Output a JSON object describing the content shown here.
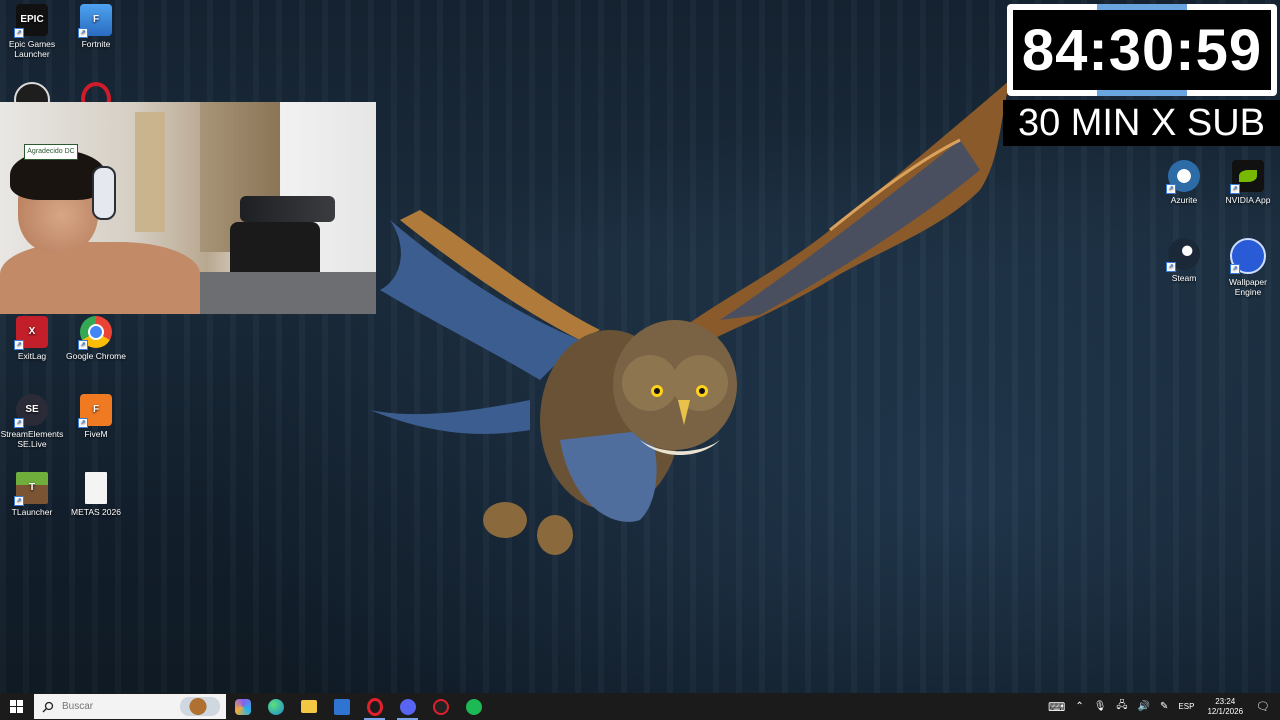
{
  "desktop_icons": [
    {
      "label": "Epic Games Launcher",
      "color": "#111111",
      "glyph": "EPIC"
    },
    {
      "label": "Fortnite",
      "color": "#3a86d9",
      "glyph": "F"
    },
    {
      "label": "ExitLag",
      "color": "#c21f2a",
      "glyph": "X"
    },
    {
      "label": "Google Chrome",
      "color": "#ffffff",
      "glyph": ""
    },
    {
      "label": "StreamElements SE.Live",
      "color": "#2b2b38",
      "glyph": "SE"
    },
    {
      "label": "FiveM",
      "color": "#f07a22",
      "glyph": "F"
    },
    {
      "label": "TLauncher",
      "color": "#5c8e2f",
      "glyph": "T"
    },
    {
      "label": "METAS 2026",
      "color": "#f1f1f1",
      "glyph": ""
    },
    {
      "label": "Azurite",
      "color": "#2e6ca8",
      "glyph": "A"
    },
    {
      "label": "NVIDIA App",
      "color": "#76b900",
      "glyph": "N"
    },
    {
      "label": "Steam",
      "color": "#1b2838",
      "glyph": "S"
    },
    {
      "label": "Wallpaper Engine",
      "color": "#2a5bd7",
      "glyph": "W"
    }
  ],
  "overlay": {
    "timer": "84:30:59",
    "subtitle": "30 MIN X SUB"
  },
  "webcam": {
    "sticker_text": "Agradecido DC"
  },
  "taskbar": {
    "search_placeholder": "Buscar",
    "apps": [
      {
        "name": "copilot",
        "color": "#8a5cf0"
      },
      {
        "name": "edge",
        "color": "#1a8ad6"
      },
      {
        "name": "file-explorer",
        "color": "#f2c744"
      },
      {
        "name": "mail",
        "color": "#2f74d0"
      },
      {
        "name": "opera",
        "color": "#e0202c"
      },
      {
        "name": "discord",
        "color": "#5865f2"
      },
      {
        "name": "streamer-app",
        "color": "#222222"
      },
      {
        "name": "spotify",
        "color": "#1db954"
      }
    ],
    "language": "ESP",
    "time": "23:24",
    "date": "12/1/2026"
  }
}
